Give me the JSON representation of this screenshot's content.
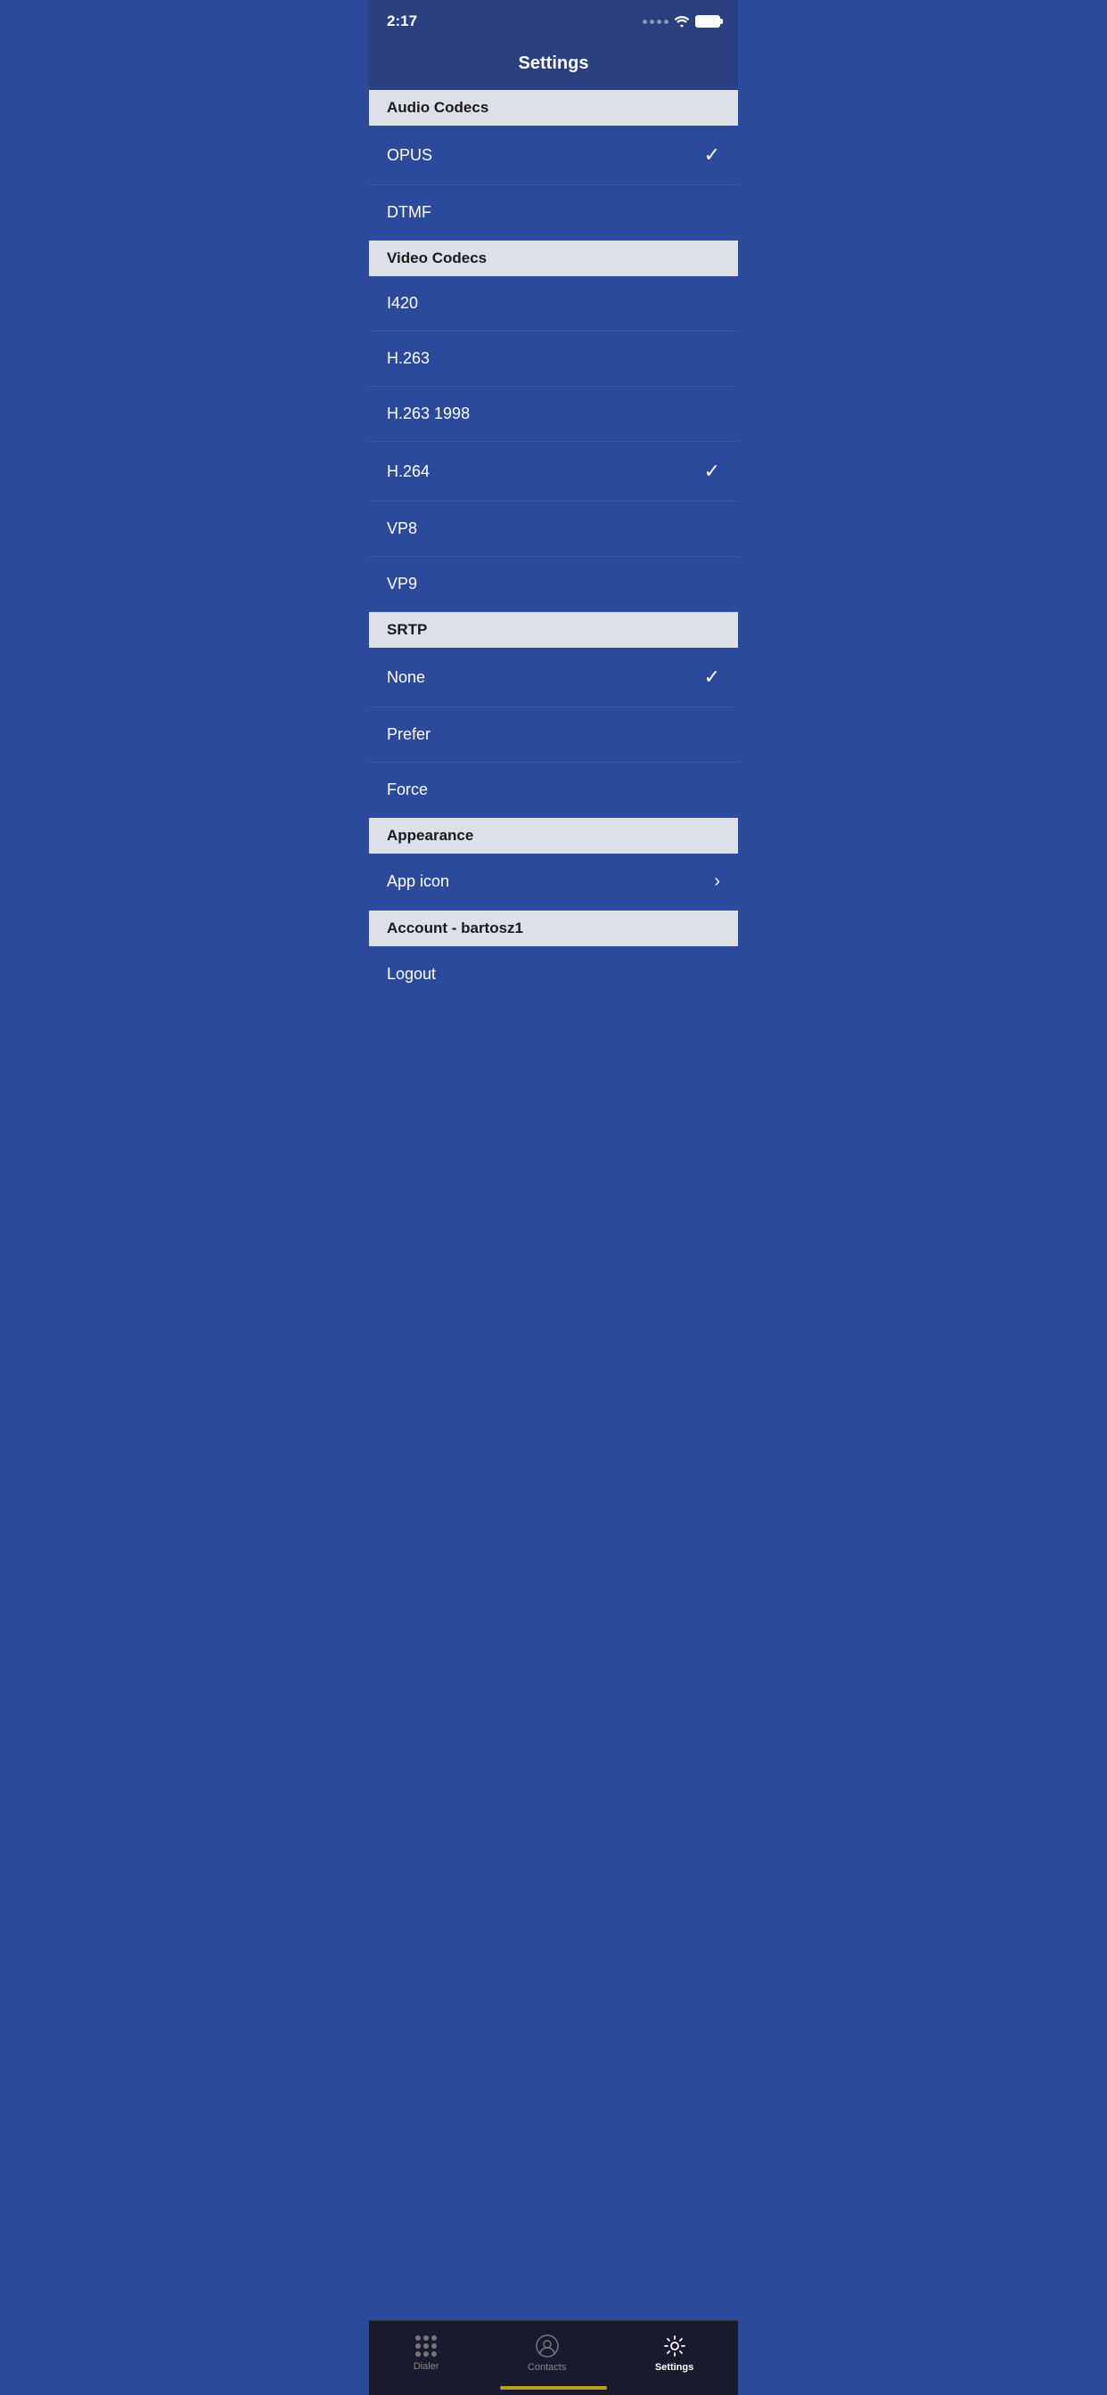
{
  "statusBar": {
    "time": "2:17"
  },
  "header": {
    "title": "Settings"
  },
  "sections": [
    {
      "id": "audio-codecs",
      "label": "Audio Codecs",
      "items": [
        {
          "id": "opus",
          "label": "OPUS",
          "checked": true,
          "chevron": false
        },
        {
          "id": "dtmf",
          "label": "DTMF",
          "checked": false,
          "chevron": false
        }
      ]
    },
    {
      "id": "video-codecs",
      "label": "Video Codecs",
      "items": [
        {
          "id": "i420",
          "label": "I420",
          "checked": false,
          "chevron": false
        },
        {
          "id": "h263",
          "label": "H.263",
          "checked": false,
          "chevron": false
        },
        {
          "id": "h263-1998",
          "label": "H.263 1998",
          "checked": false,
          "chevron": false
        },
        {
          "id": "h264",
          "label": "H.264",
          "checked": true,
          "chevron": false
        },
        {
          "id": "vp8",
          "label": "VP8",
          "checked": false,
          "chevron": false
        },
        {
          "id": "vp9",
          "label": "VP9",
          "checked": false,
          "chevron": false
        }
      ]
    },
    {
      "id": "srtp",
      "label": "SRTP",
      "items": [
        {
          "id": "none",
          "label": "None",
          "checked": true,
          "chevron": false
        },
        {
          "id": "prefer",
          "label": "Prefer",
          "checked": false,
          "chevron": false
        },
        {
          "id": "force",
          "label": "Force",
          "checked": false,
          "chevron": false
        }
      ]
    },
    {
      "id": "appearance",
      "label": "Appearance",
      "items": [
        {
          "id": "app-icon",
          "label": "App icon",
          "checked": false,
          "chevron": true
        }
      ]
    },
    {
      "id": "account",
      "label": "Account - bartosz1",
      "items": [
        {
          "id": "logout",
          "label": "Logout",
          "checked": false,
          "chevron": false
        }
      ]
    }
  ],
  "bottomNav": {
    "items": [
      {
        "id": "dialer",
        "label": "Dialer",
        "active": false
      },
      {
        "id": "contacts",
        "label": "Contacts",
        "active": false
      },
      {
        "id": "settings",
        "label": "Settings",
        "active": true
      }
    ]
  }
}
